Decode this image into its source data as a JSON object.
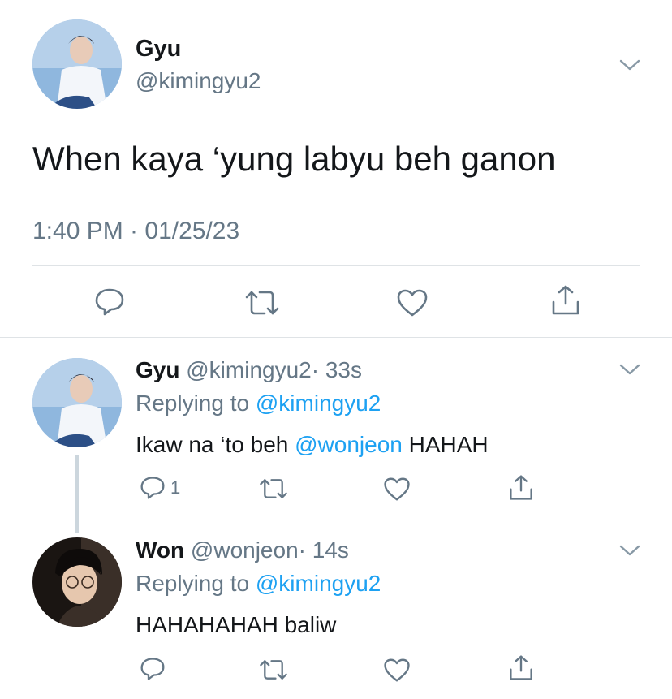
{
  "main_tweet": {
    "display_name": "Gyu",
    "handle": "@kimingyu2",
    "text": "When kaya ‘yung labyu beh ganon",
    "timestamp": "1:40 PM · 01/25/23"
  },
  "replies": [
    {
      "display_name": "Gyu",
      "handle": "@kimingyu2",
      "age": "· 33s",
      "replying_prefix": "Replying to",
      "replying_handle": "@kimingyu2",
      "text_before": "Ikaw na ‘to beh ",
      "mention": "@wonjeon",
      "text_after": " HAHAH",
      "reply_count": "1"
    },
    {
      "display_name": "Won",
      "handle": "@wonjeon",
      "age": "· 14s",
      "replying_prefix": "Replying to",
      "replying_handle": "@kimingyu2",
      "text": "HAHAHAHAH baliw"
    }
  ],
  "icons": {
    "reply": "speech-bubble-icon",
    "retweet": "retweet-icon",
    "like": "heart-icon",
    "share": "share-icon",
    "more": "chevron-down-icon"
  },
  "colors": {
    "link_blue": "#1da1f2",
    "secondary_gray": "#657786",
    "divider": "#dfe3e6"
  }
}
